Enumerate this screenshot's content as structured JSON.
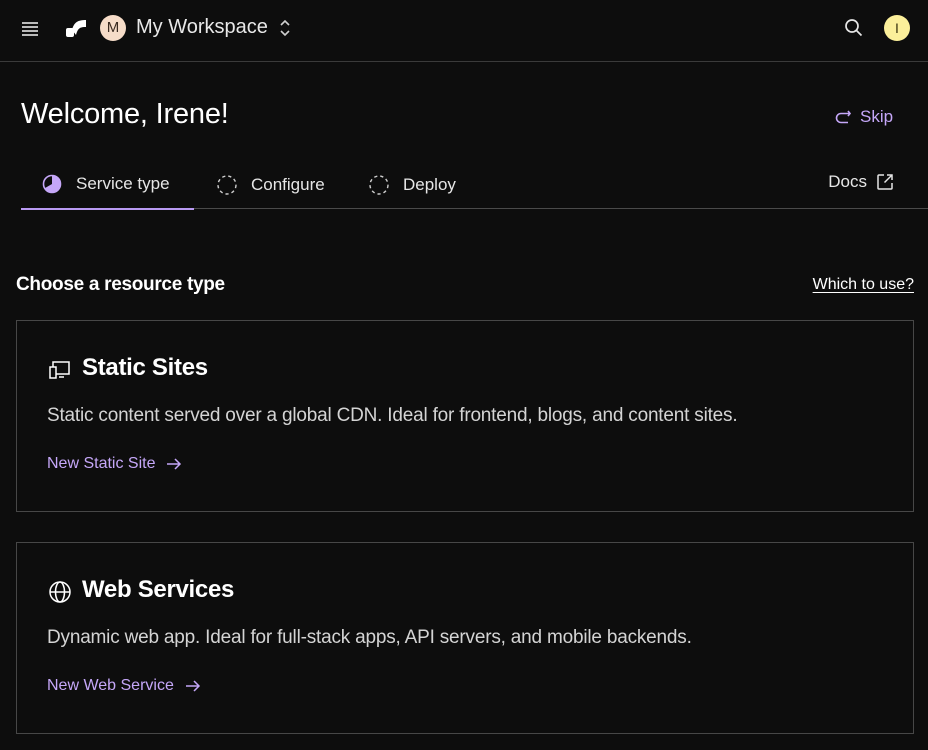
{
  "topbar": {
    "workspace_initial": "M",
    "workspace_name": "My Workspace",
    "user_initial": "I"
  },
  "welcome": {
    "title": "Welcome, Irene!",
    "skip_label": "Skip"
  },
  "tabs": [
    {
      "label": "Service type",
      "active": true
    },
    {
      "label": "Configure",
      "active": false
    },
    {
      "label": "Deploy",
      "active": false
    }
  ],
  "docs_label": "Docs",
  "section": {
    "title": "Choose a resource type",
    "help_link": "Which to use?"
  },
  "cards": [
    {
      "title": "Static Sites",
      "icon": "static-site-icon",
      "description": "Static content served over a global CDN. Ideal for frontend, blogs, and content sites.",
      "link": "New Static Site"
    },
    {
      "title": "Web Services",
      "icon": "globe-icon",
      "description": "Dynamic web app. Ideal for full-stack apps, API servers, and mobile backends.",
      "link": "New Web Service"
    }
  ],
  "colors": {
    "background": "#0d0d0d",
    "accent": "#c5a7f8",
    "active_tab_underline": "#b99af2",
    "border": "#474747",
    "workspace_avatar": "#f6dcc8",
    "user_avatar": "#fbef9a"
  }
}
